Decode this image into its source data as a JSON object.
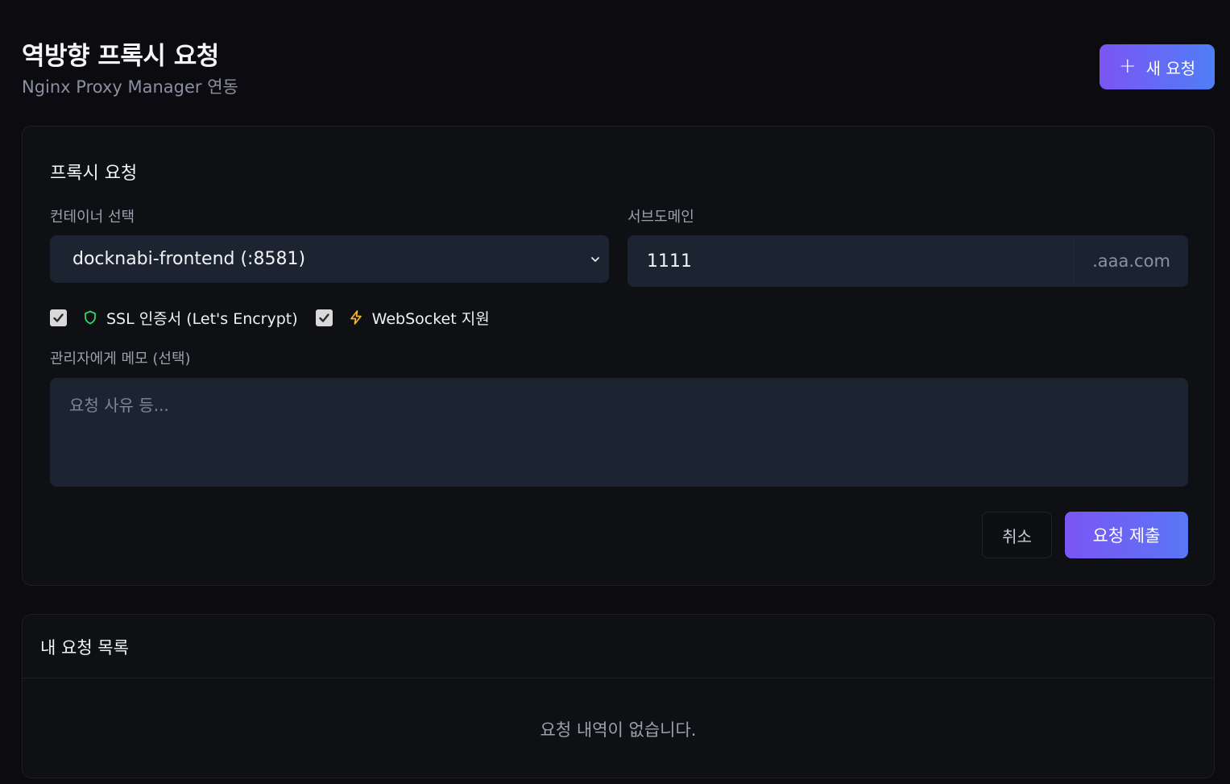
{
  "header": {
    "title": "역방향 프록시 요청",
    "subtitle": "Nginx Proxy Manager 연동",
    "new_request_label": "새 요청",
    "new_request_icon": "plus-icon"
  },
  "form": {
    "title": "프록시 요청",
    "container_label": "컨테이너 선택",
    "container_selected": "docknabi-frontend (:8581)",
    "subdomain_label": "서브도메인",
    "subdomain_value": "1111",
    "subdomain_suffix": ".aaa.com",
    "ssl_label": "SSL 인증서 (Let's Encrypt)",
    "ssl_checked": true,
    "ssl_icon": "shield-icon",
    "websocket_label": "WebSocket 지원",
    "websocket_checked": true,
    "websocket_icon": "lightning-icon",
    "memo_label": "관리자에게 메모 (선택)",
    "memo_placeholder": "요청 사유 등...",
    "memo_value": "",
    "cancel_label": "취소",
    "submit_label": "요청 제출"
  },
  "requests": {
    "title": "내 요청 목록",
    "empty_message": "요청 내역이 없습니다."
  },
  "colors": {
    "accent_start": "#7b55f3",
    "accent_end": "#4f7ef7",
    "shield": "#34d36b",
    "lightning": "#f5b82e"
  }
}
